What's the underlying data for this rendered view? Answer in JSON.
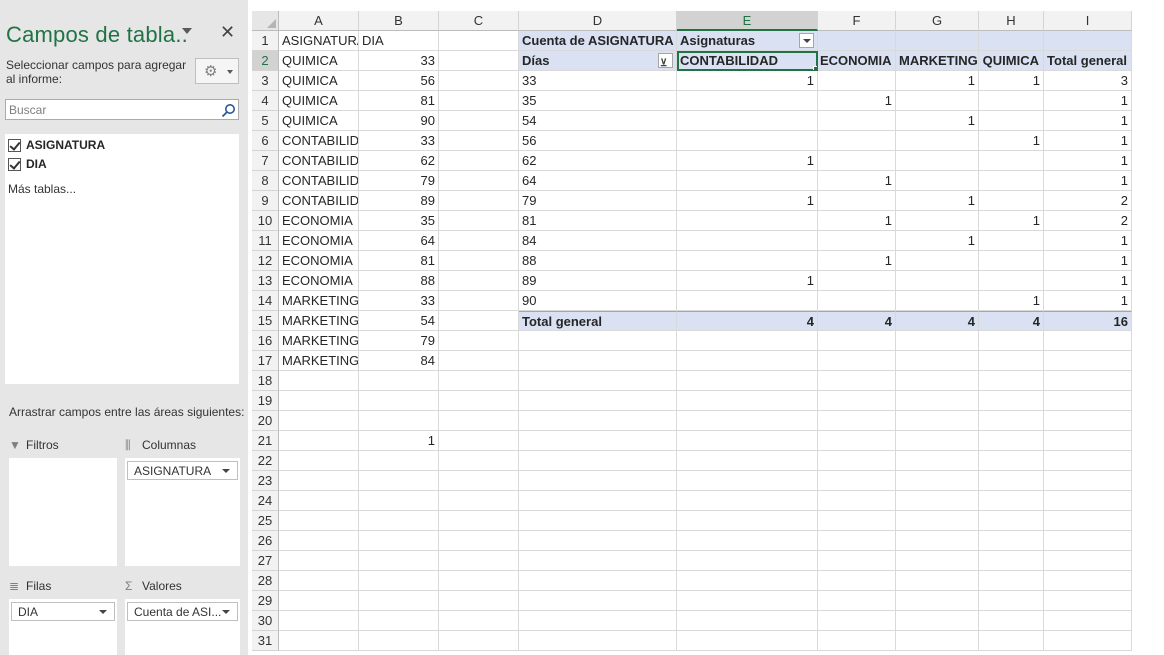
{
  "pane": {
    "title": "Campos de tabla..",
    "instructions": "Seleccionar campos para agregar al informe:",
    "search_placeholder": "Buscar",
    "fields": [
      {
        "name": "ASIGNATURA",
        "checked": true
      },
      {
        "name": "DIA",
        "checked": true
      }
    ],
    "more_tables": "Más tablas...",
    "drag_hint": "Arrastrar campos entre las áreas siguientes:",
    "areas": {
      "filters": {
        "label": "Filtros",
        "items": []
      },
      "columns": {
        "label": "Columnas",
        "items": [
          "ASIGNATURA"
        ]
      },
      "rows": {
        "label": "Filas",
        "items": [
          "DIA"
        ]
      },
      "values": {
        "label": "Valores",
        "items": [
          "Cuenta de ASI..."
        ]
      }
    }
  },
  "sheet": {
    "columns": [
      "A",
      "B",
      "C",
      "D",
      "E",
      "F",
      "G",
      "H",
      "I"
    ],
    "selected_column": "E",
    "selected_row": 2,
    "row_count": 31,
    "source_table": {
      "headers": [
        "ASIGNATURA",
        "DIA"
      ],
      "rows": [
        [
          "QUIMICA",
          "33"
        ],
        [
          "QUIMICA",
          "56"
        ],
        [
          "QUIMICA",
          "81"
        ],
        [
          "QUIMICA",
          "90"
        ],
        [
          "CONTABILIDAD",
          "33"
        ],
        [
          "CONTABILIDAD",
          "62"
        ],
        [
          "CONTABILIDAD",
          "79"
        ],
        [
          "CONTABILIDAD",
          "89"
        ],
        [
          "ECONOMIA",
          "35"
        ],
        [
          "ECONOMIA",
          "64"
        ],
        [
          "ECONOMIA",
          "81"
        ],
        [
          "ECONOMIA",
          "88"
        ],
        [
          "MARKETING",
          "33"
        ],
        [
          "MARKETING",
          "54"
        ],
        [
          "MARKETING",
          "79"
        ],
        [
          "MARKETING",
          "84"
        ]
      ]
    },
    "extra_cell": {
      "row": 21,
      "col": "B",
      "value": "1"
    },
    "pivot": {
      "value_label": "Cuenta de ASIGNATURA",
      "column_label": "Asignaturas",
      "row_label": "Días",
      "column_items": [
        "CONTABILIDAD",
        "ECONOMIA",
        "MARKETING",
        "QUIMICA",
        "Total general"
      ],
      "rows": [
        {
          "label": "33",
          "values": [
            "1",
            "",
            "1",
            "1",
            "3"
          ]
        },
        {
          "label": "35",
          "values": [
            "",
            "1",
            "",
            "",
            "1"
          ]
        },
        {
          "label": "54",
          "values": [
            "",
            "",
            "1",
            "",
            "1"
          ]
        },
        {
          "label": "56",
          "values": [
            "",
            "",
            "",
            "1",
            "1"
          ]
        },
        {
          "label": "62",
          "values": [
            "1",
            "",
            "",
            "",
            "1"
          ]
        },
        {
          "label": "64",
          "values": [
            "",
            "1",
            "",
            "",
            "1"
          ]
        },
        {
          "label": "79",
          "values": [
            "1",
            "",
            "1",
            "",
            "2"
          ]
        },
        {
          "label": "81",
          "values": [
            "",
            "1",
            "",
            "1",
            "2"
          ]
        },
        {
          "label": "84",
          "values": [
            "",
            "",
            "1",
            "",
            "1"
          ]
        },
        {
          "label": "88",
          "values": [
            "",
            "1",
            "",
            "",
            "1"
          ]
        },
        {
          "label": "89",
          "values": [
            "1",
            "",
            "",
            "",
            "1"
          ]
        },
        {
          "label": "90",
          "values": [
            "",
            "",
            "",
            "1",
            "1"
          ]
        }
      ],
      "total_label": "Total general",
      "totals": [
        "4",
        "4",
        "4",
        "4",
        "16"
      ]
    }
  },
  "colors": {
    "accent": "#217346",
    "pivot_band": "#d9e1f2"
  }
}
